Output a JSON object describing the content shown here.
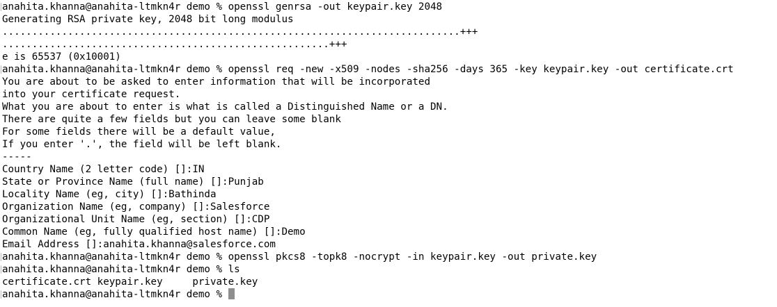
{
  "terminal": {
    "lines": [
      {
        "text": "anahita.khanna@anahita-ltmkn4r demo % openssl genrsa -out keypair.key 2048",
        "prompt": true
      },
      {
        "text": "Generating RSA private key, 2048 bit long modulus",
        "prompt": false
      },
      {
        "text": ".............................................................................+++",
        "prompt": false
      },
      {
        "text": ".......................................................+++",
        "prompt": false
      },
      {
        "text": "e is 65537 (0x10001)",
        "prompt": false
      },
      {
        "text": "anahita.khanna@anahita-ltmkn4r demo % openssl req -new -x509 -nodes -sha256 -days 365 -key keypair.key -out certificate.crt",
        "prompt": true
      },
      {
        "text": "You are about to be asked to enter information that will be incorporated",
        "prompt": false
      },
      {
        "text": "into your certificate request.",
        "prompt": false
      },
      {
        "text": "What you are about to enter is what is called a Distinguished Name or a DN.",
        "prompt": false
      },
      {
        "text": "There are quite a few fields but you can leave some blank",
        "prompt": false
      },
      {
        "text": "For some fields there will be a default value,",
        "prompt": false
      },
      {
        "text": "If you enter '.', the field will be left blank.",
        "prompt": false
      },
      {
        "text": "-----",
        "prompt": false
      },
      {
        "text": "Country Name (2 letter code) []:IN",
        "prompt": false
      },
      {
        "text": "State or Province Name (full name) []:Punjab",
        "prompt": false
      },
      {
        "text": "Locality Name (eg, city) []:Bathinda",
        "prompt": false
      },
      {
        "text": "Organization Name (eg, company) []:Salesforce",
        "prompt": false
      },
      {
        "text": "Organizational Unit Name (eg, section) []:CDP",
        "prompt": false
      },
      {
        "text": "Common Name (eg, fully qualified host name) []:Demo",
        "prompt": false
      },
      {
        "text": "Email Address []:anahita.khanna@salesforce.com",
        "prompt": false
      },
      {
        "text": "anahita.khanna@anahita-ltmkn4r demo % openssl pkcs8 -topk8 -nocrypt -in keypair.key -out private.key",
        "prompt": true
      },
      {
        "text": "anahita.khanna@anahita-ltmkn4r demo % ls",
        "prompt": true
      },
      {
        "text": "certificate.crt keypair.key     private.key",
        "prompt": false
      }
    ],
    "current_prompt": "anahita.khanna@anahita-ltmkn4r demo % "
  },
  "colors": {
    "background": "#ffffff",
    "text": "#000000",
    "cursor": "#8e8e8e"
  }
}
